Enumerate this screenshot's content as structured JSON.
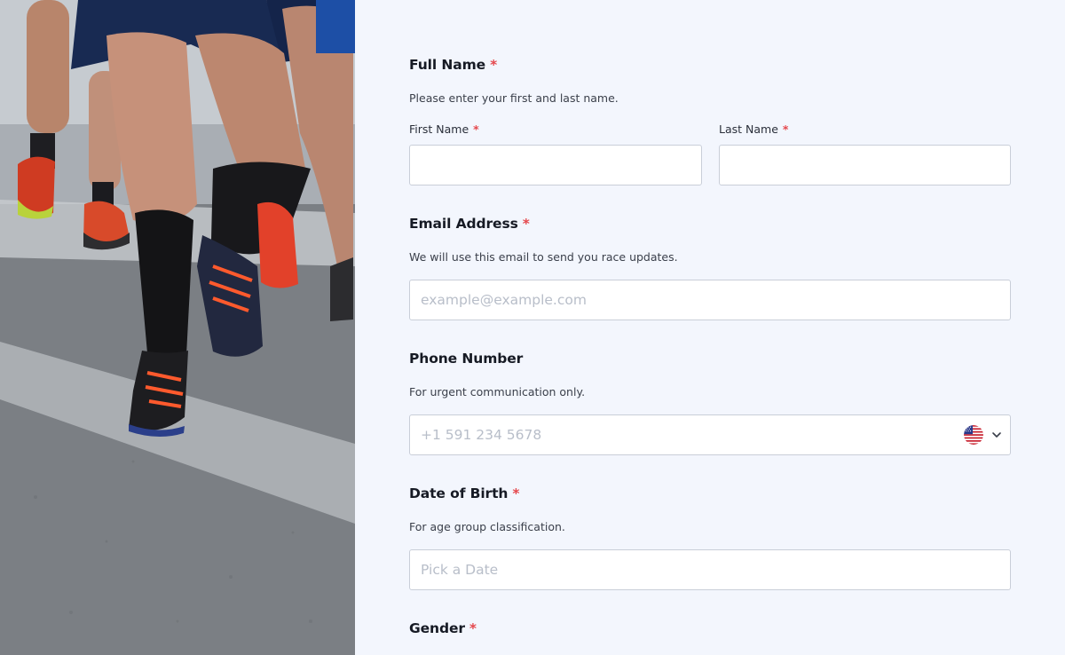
{
  "form": {
    "full_name": {
      "title": "Full Name",
      "required_mark": "*",
      "help": "Please enter your first and last name.",
      "first_label": "First Name",
      "last_label": "Last Name",
      "first_value": "",
      "last_value": ""
    },
    "email": {
      "title": "Email Address",
      "required_mark": "*",
      "help": "We will use this email to send you race updates.",
      "placeholder": "example@example.com",
      "value": ""
    },
    "phone": {
      "title": "Phone Number",
      "help": "For urgent communication only.",
      "placeholder": "+1 591 234 5678",
      "value": "",
      "country_icon": "us-flag-icon"
    },
    "dob": {
      "title": "Date of Birth",
      "required_mark": "*",
      "help": "For age group classification.",
      "placeholder": "Pick a Date",
      "value": ""
    },
    "gender": {
      "title": "Gender",
      "required_mark": "*"
    }
  },
  "colors": {
    "background": "#f3f6fd",
    "required": "#e5484d",
    "field_border": "#c9ced8",
    "placeholder": "#b8bec9"
  },
  "hero_image": "marathon-runners-legs-photo"
}
